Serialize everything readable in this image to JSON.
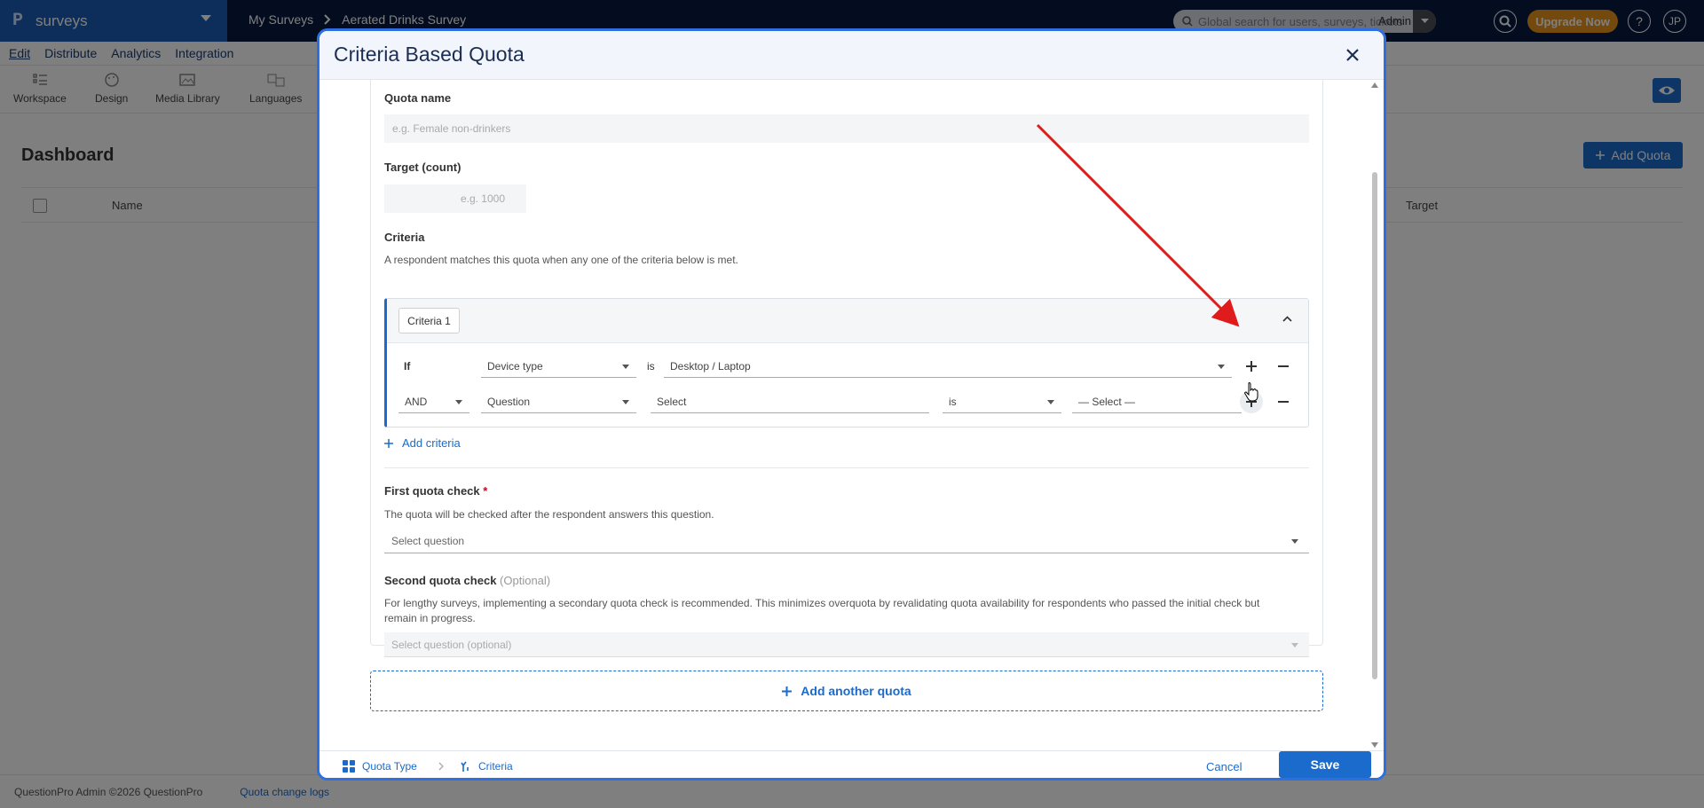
{
  "topbar": {
    "brand_logo": "P",
    "brand_name": "surveys",
    "breadcrumb": [
      "My Surveys",
      "Aerated Drinks Survey"
    ],
    "search_placeholder": "Global search for users, surveys, tickets",
    "admin_label": "Admin",
    "upgrade_label": "Upgrade Now",
    "help_label": "?",
    "avatar_initials": "JP"
  },
  "menu": [
    "Edit",
    "Distribute",
    "Analytics",
    "Integration"
  ],
  "toolbar": [
    "Workspace",
    "Design",
    "Media Library",
    "Languages"
  ],
  "dashboard": {
    "title": "Dashboard",
    "add_quota": "Add Quota",
    "columns": {
      "name": "Name",
      "target": "Target"
    }
  },
  "footer": {
    "copyright": "QuestionPro Admin ©2026 QuestionPro",
    "logs": "Quota change logs"
  },
  "modal": {
    "title": "Criteria Based Quota",
    "quota_name_label": "Quota name",
    "quota_name_placeholder": "e.g. Female non-drinkers",
    "target_label": "Target (count)",
    "target_placeholder": "e.g. 1000",
    "criteria_label": "Criteria",
    "criteria_hint": "A respondent matches this quota when any one of the criteria below is met.",
    "criteria_tag": "Criteria 1",
    "row1": {
      "prefix": "If",
      "field": "Device type",
      "op": "is",
      "value": "Desktop / Laptop"
    },
    "row2": {
      "conj": "AND",
      "field": "Question",
      "value": "Select",
      "op": "is",
      "answer": "— Select —"
    },
    "add_criteria": "Add criteria",
    "first_check_label": "First quota check",
    "first_check_required": "*",
    "first_check_hint": "The quota will be checked after the respondent answers this question.",
    "first_check_placeholder": "Select question",
    "second_check_label": "Second quota check",
    "second_check_optional": "(Optional)",
    "second_check_hint_1": "For lengthy surveys, implementing a secondary quota check is recommended. This minimizes overquota by revalidating quota availability for respondents who passed the initial check but",
    "second_check_hint_2": "remain in progress.",
    "second_check_placeholder": "Select question (optional)",
    "add_another": "Add another quota",
    "footer": {
      "step1": "Quota Type",
      "step2": "Criteria",
      "cancel": "Cancel",
      "save": "Save"
    }
  },
  "colors": {
    "accent": "#1a6bcc",
    "annotation_arrow": "#e01b1b",
    "upgrade": "#e8921b"
  }
}
